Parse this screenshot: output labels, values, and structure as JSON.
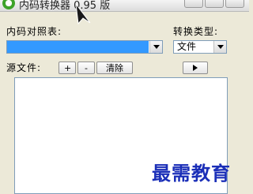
{
  "window": {
    "title": "内码转换器 0.95 版"
  },
  "form": {
    "code_table_label": "内码对照表:",
    "code_table_value": "",
    "convert_type_label": "转换类型:",
    "convert_type_value": "文件",
    "source_file_label": "源文件:",
    "add_label": "+",
    "remove_label": "-",
    "clear_label": "清除"
  },
  "watermark": "最需教育",
  "colors": {
    "selection": "#3399ff",
    "watermark": "#1b2fb8",
    "window_bg": "#ece9d8"
  },
  "icons": {
    "app": "recycle-icon",
    "cursor": "arrow-cursor-icon",
    "run": "play-icon"
  }
}
